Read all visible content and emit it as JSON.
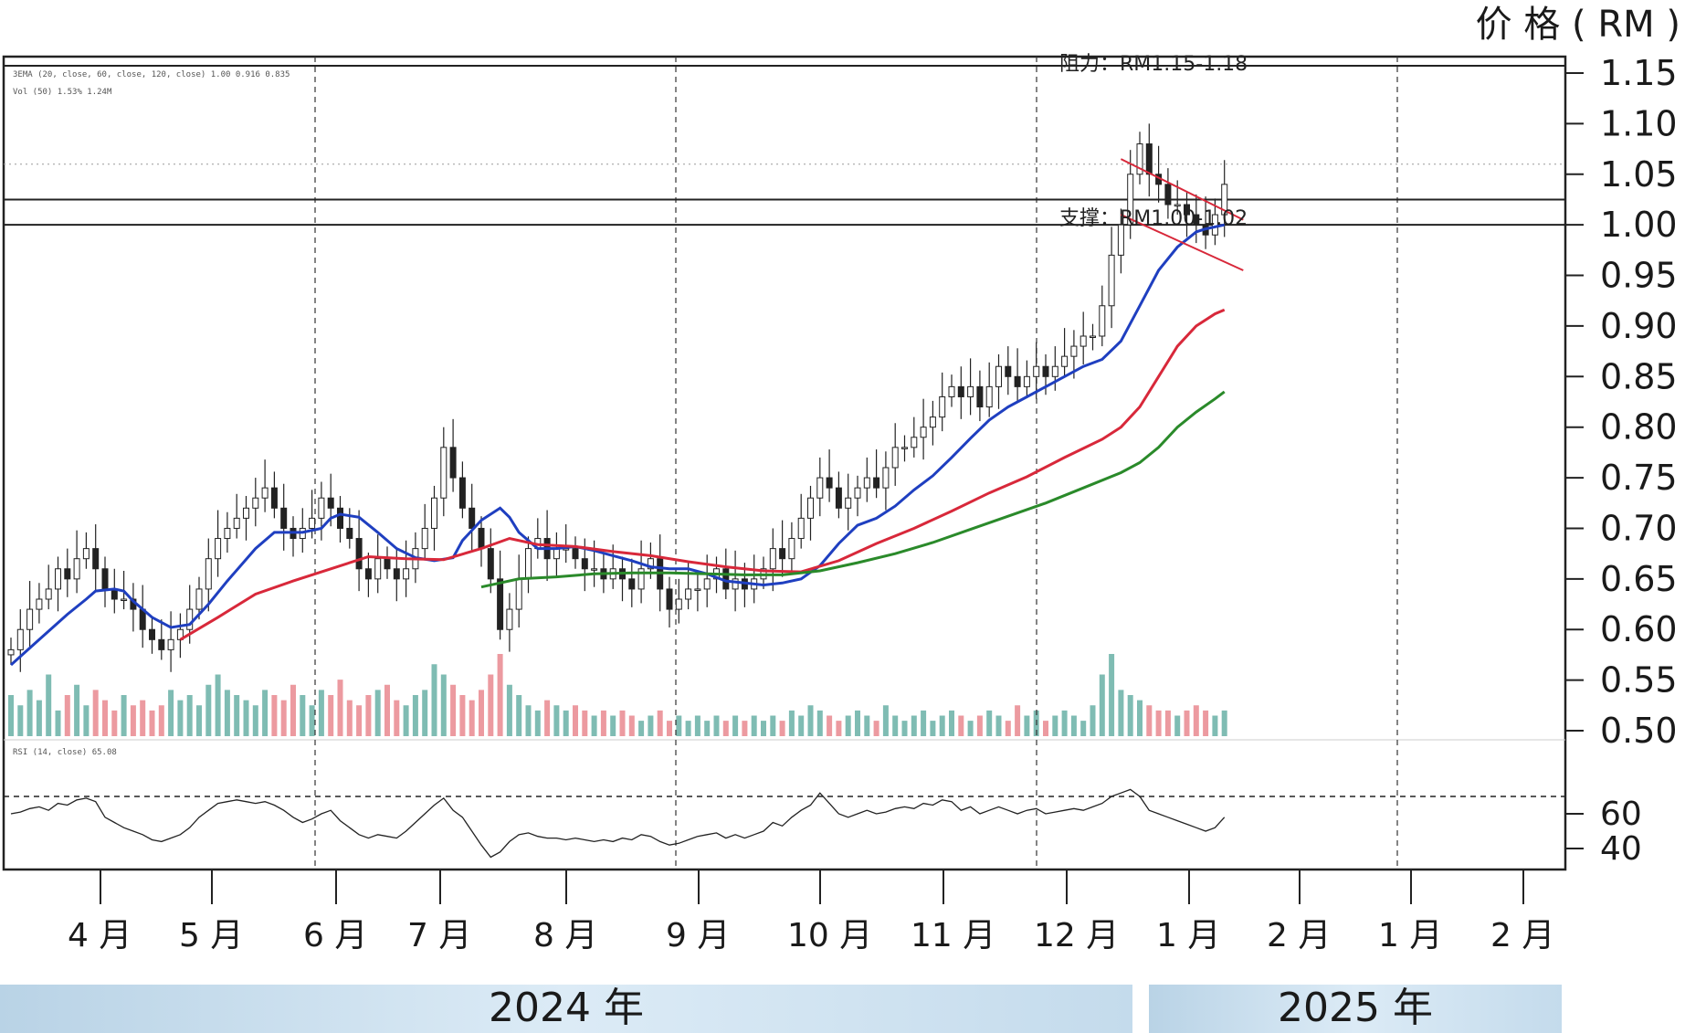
{
  "chart_data": {
    "type": "candlestick",
    "unit_label": "价 格 ( RM )",
    "y_ticks": [
      "1.15",
      "1.10",
      "1.05",
      "1.00",
      "0.95",
      "0.90",
      "0.85",
      "0.80",
      "0.75",
      "0.70",
      "0.65",
      "0.60",
      "0.55",
      "0.50"
    ],
    "ylim": [
      0.5,
      1.15
    ],
    "rsi_ticks": [
      "60",
      "40"
    ],
    "rsi_ylim": [
      30,
      100
    ],
    "rsi_overbought": 70,
    "months": [
      "4 月",
      "5 月",
      "6 月",
      "7 月",
      "8 月",
      "9 月",
      "10 月",
      "11 月",
      "12 月",
      "1 月",
      "2 月",
      "1 月",
      "2 月"
    ],
    "years": [
      {
        "label": "2024 年"
      },
      {
        "label": "2025 年"
      }
    ],
    "indicator_line_1": "3EMA (20, close, 60, close, 120, close)  1.00  0.916  0.835",
    "indicator_line_2": "Vol (50)  1.53%  1.24M",
    "indicator_line_3": "RSI (14, close)  65.08",
    "resistance": {
      "label": "阻力：RM1.15-1.18",
      "values": [
        1.15,
        1.18
      ]
    },
    "support": {
      "label": "支撑：RM1.00-1.02",
      "values": [
        1.0,
        1.02
      ]
    },
    "extra_level": 1.025,
    "series": [
      {
        "name": "EMA20",
        "color": "#1f3fc0",
        "points": [
          [
            0,
            0.565
          ],
          [
            3,
            0.59
          ],
          [
            6,
            0.615
          ],
          [
            8,
            0.63
          ],
          [
            9,
            0.638
          ],
          [
            11,
            0.64
          ],
          [
            12,
            0.638
          ],
          [
            13,
            0.628
          ],
          [
            15,
            0.612
          ],
          [
            17,
            0.602
          ],
          [
            19,
            0.605
          ],
          [
            21,
            0.625
          ],
          [
            23,
            0.648
          ],
          [
            26,
            0.68
          ],
          [
            28,
            0.696
          ],
          [
            31,
            0.696
          ],
          [
            33,
            0.7
          ],
          [
            34,
            0.71
          ],
          [
            35,
            0.714
          ],
          [
            37,
            0.711
          ],
          [
            39,
            0.696
          ],
          [
            41,
            0.68
          ],
          [
            43,
            0.671
          ],
          [
            45,
            0.668
          ],
          [
            47,
            0.671
          ],
          [
            48,
            0.688
          ],
          [
            50,
            0.708
          ],
          [
            52,
            0.72
          ],
          [
            53,
            0.711
          ],
          [
            54,
            0.696
          ],
          [
            56,
            0.68
          ],
          [
            58,
            0.68
          ],
          [
            60,
            0.682
          ],
          [
            62,
            0.678
          ],
          [
            64,
            0.673
          ],
          [
            66,
            0.668
          ],
          [
            68,
            0.662
          ],
          [
            70,
            0.66
          ],
          [
            72,
            0.66
          ],
          [
            74,
            0.655
          ],
          [
            76,
            0.648
          ],
          [
            78,
            0.646
          ],
          [
            80,
            0.644
          ],
          [
            82,
            0.646
          ],
          [
            84,
            0.65
          ],
          [
            86,
            0.663
          ],
          [
            88,
            0.685
          ],
          [
            90,
            0.703
          ],
          [
            92,
            0.71
          ],
          [
            94,
            0.722
          ],
          [
            96,
            0.738
          ],
          [
            98,
            0.752
          ],
          [
            100,
            0.77
          ],
          [
            102,
            0.789
          ],
          [
            104,
            0.807
          ],
          [
            106,
            0.82
          ],
          [
            108,
            0.83
          ],
          [
            110,
            0.84
          ],
          [
            112,
            0.85
          ],
          [
            114,
            0.86
          ],
          [
            116,
            0.867
          ],
          [
            118,
            0.885
          ],
          [
            120,
            0.92
          ],
          [
            122,
            0.955
          ],
          [
            124,
            0.978
          ],
          [
            126,
            0.993
          ],
          [
            127,
            0.996
          ],
          [
            129,
            1.0
          ]
        ]
      },
      {
        "name": "EMA60",
        "color": "#d8283a",
        "points": [
          [
            18,
            0.59
          ],
          [
            22,
            0.612
          ],
          [
            26,
            0.635
          ],
          [
            30,
            0.648
          ],
          [
            34,
            0.66
          ],
          [
            38,
            0.672
          ],
          [
            42,
            0.67
          ],
          [
            46,
            0.669
          ],
          [
            50,
            0.68
          ],
          [
            53,
            0.69
          ],
          [
            56,
            0.684
          ],
          [
            60,
            0.682
          ],
          [
            64,
            0.677
          ],
          [
            68,
            0.673
          ],
          [
            72,
            0.667
          ],
          [
            76,
            0.662
          ],
          [
            80,
            0.658
          ],
          [
            84,
            0.657
          ],
          [
            88,
            0.668
          ],
          [
            92,
            0.685
          ],
          [
            96,
            0.7
          ],
          [
            100,
            0.717
          ],
          [
            104,
            0.735
          ],
          [
            108,
            0.751
          ],
          [
            112,
            0.77
          ],
          [
            116,
            0.788
          ],
          [
            118,
            0.8
          ],
          [
            120,
            0.82
          ],
          [
            122,
            0.85
          ],
          [
            124,
            0.88
          ],
          [
            126,
            0.9
          ],
          [
            128,
            0.912
          ],
          [
            129,
            0.916
          ]
        ]
      },
      {
        "name": "EMA120",
        "color": "#2a8a2a",
        "points": [
          [
            50,
            0.642
          ],
          [
            54,
            0.65
          ],
          [
            58,
            0.652
          ],
          [
            62,
            0.655
          ],
          [
            66,
            0.656
          ],
          [
            70,
            0.656
          ],
          [
            74,
            0.655
          ],
          [
            78,
            0.654
          ],
          [
            82,
            0.654
          ],
          [
            86,
            0.658
          ],
          [
            90,
            0.666
          ],
          [
            94,
            0.675
          ],
          [
            98,
            0.686
          ],
          [
            102,
            0.699
          ],
          [
            106,
            0.712
          ],
          [
            110,
            0.725
          ],
          [
            114,
            0.74
          ],
          [
            118,
            0.755
          ],
          [
            120,
            0.765
          ],
          [
            122,
            0.78
          ],
          [
            124,
            0.8
          ],
          [
            126,
            0.815
          ],
          [
            128,
            0.828
          ],
          [
            129,
            0.835
          ]
        ]
      }
    ],
    "price_close": [
      0.58,
      0.6,
      0.62,
      0.63,
      0.64,
      0.66,
      0.65,
      0.67,
      0.68,
      0.66,
      0.64,
      0.63,
      0.63,
      0.62,
      0.6,
      0.59,
      0.58,
      0.59,
      0.6,
      0.62,
      0.64,
      0.67,
      0.69,
      0.7,
      0.71,
      0.72,
      0.73,
      0.74,
      0.72,
      0.7,
      0.69,
      0.7,
      0.71,
      0.73,
      0.72,
      0.7,
      0.69,
      0.66,
      0.65,
      0.67,
      0.66,
      0.65,
      0.66,
      0.68,
      0.7,
      0.73,
      0.78,
      0.75,
      0.72,
      0.7,
      0.68,
      0.65,
      0.6,
      0.62,
      0.65,
      0.68,
      0.69,
      0.67,
      0.68,
      0.68,
      0.67,
      0.66,
      0.66,
      0.65,
      0.66,
      0.65,
      0.64,
      0.66,
      0.67,
      0.64,
      0.62,
      0.63,
      0.64,
      0.64,
      0.65,
      0.66,
      0.64,
      0.65,
      0.64,
      0.65,
      0.66,
      0.68,
      0.67,
      0.69,
      0.71,
      0.73,
      0.75,
      0.74,
      0.72,
      0.73,
      0.74,
      0.75,
      0.74,
      0.76,
      0.78,
      0.78,
      0.79,
      0.8,
      0.81,
      0.83,
      0.84,
      0.83,
      0.84,
      0.82,
      0.84,
      0.86,
      0.85,
      0.84,
      0.85,
      0.86,
      0.85,
      0.86,
      0.87,
      0.88,
      0.89,
      0.89,
      0.92,
      0.97,
      1.0,
      1.05,
      1.08,
      1.05,
      1.04,
      1.02,
      1.02,
      1.01,
      1.0,
      0.99,
      1.01,
      1.04
    ],
    "volume": [
      8,
      6,
      9,
      7,
      12,
      5,
      8,
      10,
      6,
      9,
      7,
      5,
      8,
      6,
      7,
      5,
      6,
      9,
      7,
      8,
      6,
      10,
      12,
      9,
      8,
      7,
      6,
      9,
      8,
      7,
      10,
      8,
      6,
      9,
      8,
      11,
      7,
      6,
      8,
      9,
      10,
      7,
      6,
      8,
      9,
      14,
      12,
      10,
      8,
      7,
      9,
      12,
      16,
      10,
      8,
      6,
      5,
      7,
      6,
      5,
      6,
      5,
      4,
      5,
      4,
      5,
      4,
      3,
      4,
      5,
      3,
      4,
      3,
      4,
      3,
      4,
      3,
      4,
      3,
      4,
      3,
      4,
      3,
      5,
      4,
      6,
      5,
      4,
      3,
      4,
      5,
      4,
      3,
      6,
      4,
      3,
      4,
      5,
      3,
      4,
      5,
      4,
      3,
      4,
      5,
      4,
      3,
      6,
      4,
      5,
      3,
      4,
      5,
      4,
      3,
      6,
      12,
      16,
      9,
      8,
      7,
      6,
      5,
      5,
      4,
      5,
      6,
      5,
      4,
      5
    ],
    "rsi": [
      60,
      61,
      63,
      64,
      62,
      66,
      65,
      68,
      69,
      67,
      58,
      55,
      52,
      50,
      48,
      45,
      44,
      46,
      48,
      52,
      58,
      62,
      66,
      67,
      68,
      67,
      66,
      67,
      65,
      62,
      58,
      55,
      57,
      60,
      62,
      56,
      52,
      48,
      46,
      48,
      47,
      46,
      50,
      55,
      60,
      65,
      69,
      62,
      58,
      50,
      42,
      35,
      38,
      44,
      48,
      49,
      47,
      46,
      46,
      45,
      46,
      45,
      44,
      45,
      44,
      46,
      45,
      48,
      47,
      44,
      42,
      43,
      45,
      47,
      48,
      49,
      46,
      48,
      46,
      48,
      50,
      55,
      53,
      58,
      62,
      65,
      72,
      66,
      60,
      58,
      60,
      62,
      60,
      61,
      63,
      64,
      63,
      66,
      65,
      68,
      67,
      62,
      64,
      60,
      62,
      64,
      62,
      60,
      62,
      63,
      60,
      61,
      62,
      63,
      62,
      64,
      66,
      70,
      72,
      74,
      70,
      62,
      60,
      58,
      56,
      54,
      52,
      50,
      52,
      58
    ]
  }
}
